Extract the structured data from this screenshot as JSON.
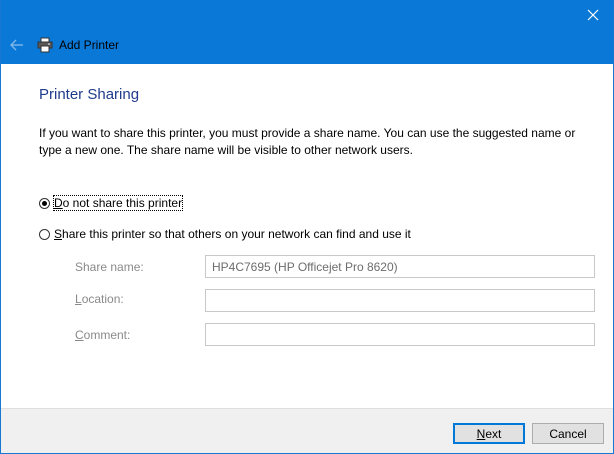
{
  "window": {
    "title": "Add Printer"
  },
  "page": {
    "heading": "Printer Sharing",
    "description": "If you want to share this printer, you must provide a share name. You can use the suggested name or type a new one. The share name will be visible to other network users."
  },
  "sharing": {
    "options": [
      {
        "accel": "D",
        "rest": "o not share this printer",
        "selected": true
      },
      {
        "accel": "S",
        "rest": "hare this printer so that others on your network can find and use it",
        "selected": false
      }
    ],
    "fields": {
      "share_name": {
        "label_accel": "",
        "label": "Share name:",
        "value": "HP4C7695 (HP Officejet Pro 8620)"
      },
      "location": {
        "label_accel": "L",
        "label_rest": "ocation:",
        "value": ""
      },
      "comment": {
        "label_accel": "C",
        "label_rest": "omment:",
        "value": ""
      }
    }
  },
  "footer": {
    "next_accel": "N",
    "next_rest": "ext",
    "cancel_label": "Cancel"
  },
  "colors": {
    "titlebar": "#0a78d7",
    "heading": "#1f3c8c",
    "default_button_border": "#0078d7"
  },
  "icons": {
    "close": "close-icon",
    "back": "back-arrow-icon",
    "app": "printer-icon"
  }
}
